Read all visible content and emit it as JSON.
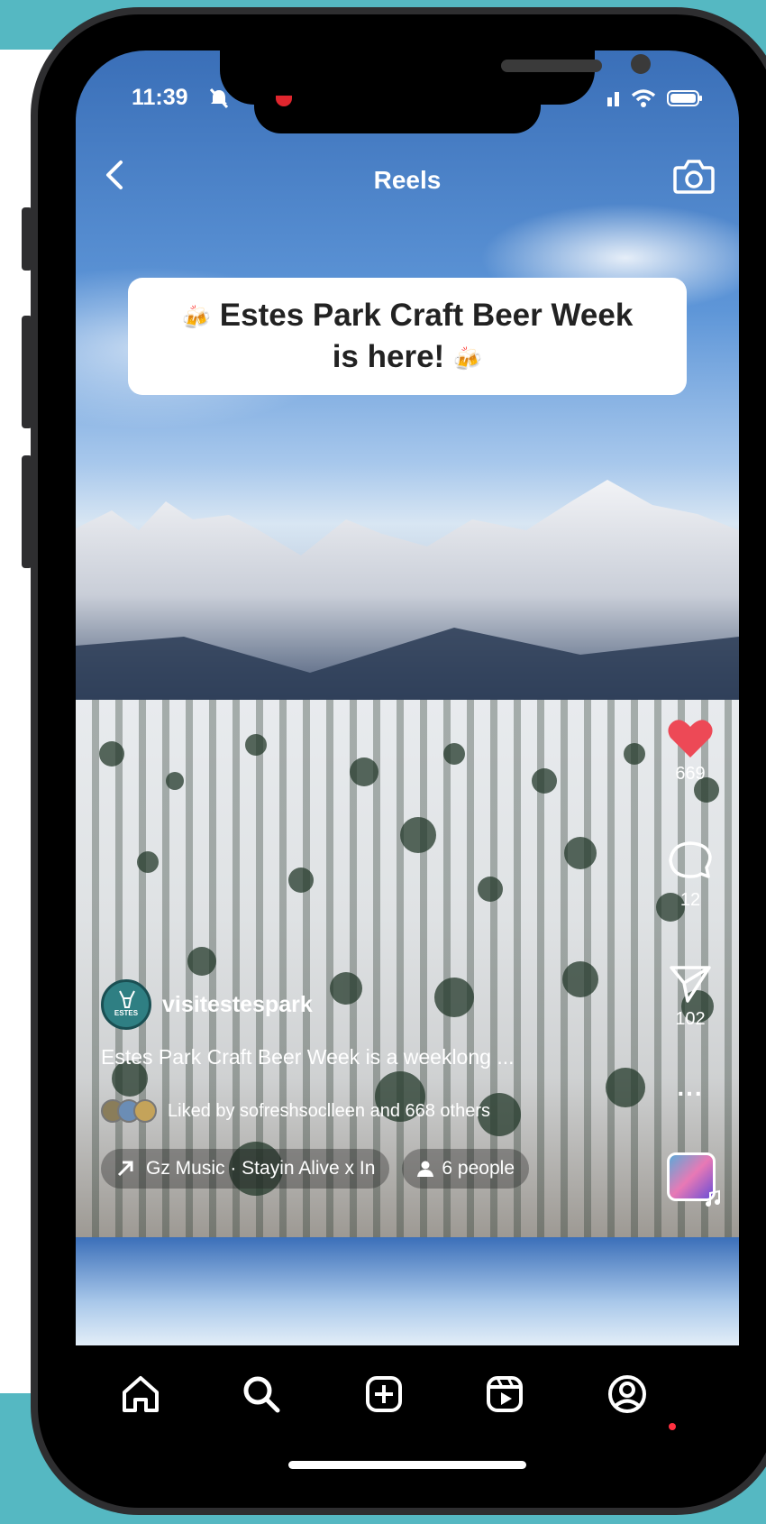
{
  "status_bar": {
    "time": "11:39"
  },
  "header": {
    "title": "Reels",
    "back_icon": "chevron-left-icon",
    "camera_icon": "camera-icon"
  },
  "caption_overlay": {
    "line1": "Estes Park Craft Beer Week",
    "line2": "is here!",
    "emoji": "🍻"
  },
  "actions": {
    "like_count": "669",
    "comment_count": "12",
    "share_count": "102",
    "more_label": "...",
    "like_color": "#ed4956"
  },
  "post": {
    "username": "visitestespark",
    "avatar_text": "ESTES",
    "description": "Estes Park Craft Beer Week is a weeklong ...",
    "liked_by": "Liked by sofreshsoclleen and 668 others",
    "music": "Gz Music · Stayin Alive x In",
    "people": "6 people"
  },
  "tabs": [
    "home-icon",
    "search-icon",
    "create-icon",
    "reels-icon",
    "profile-icon"
  ]
}
